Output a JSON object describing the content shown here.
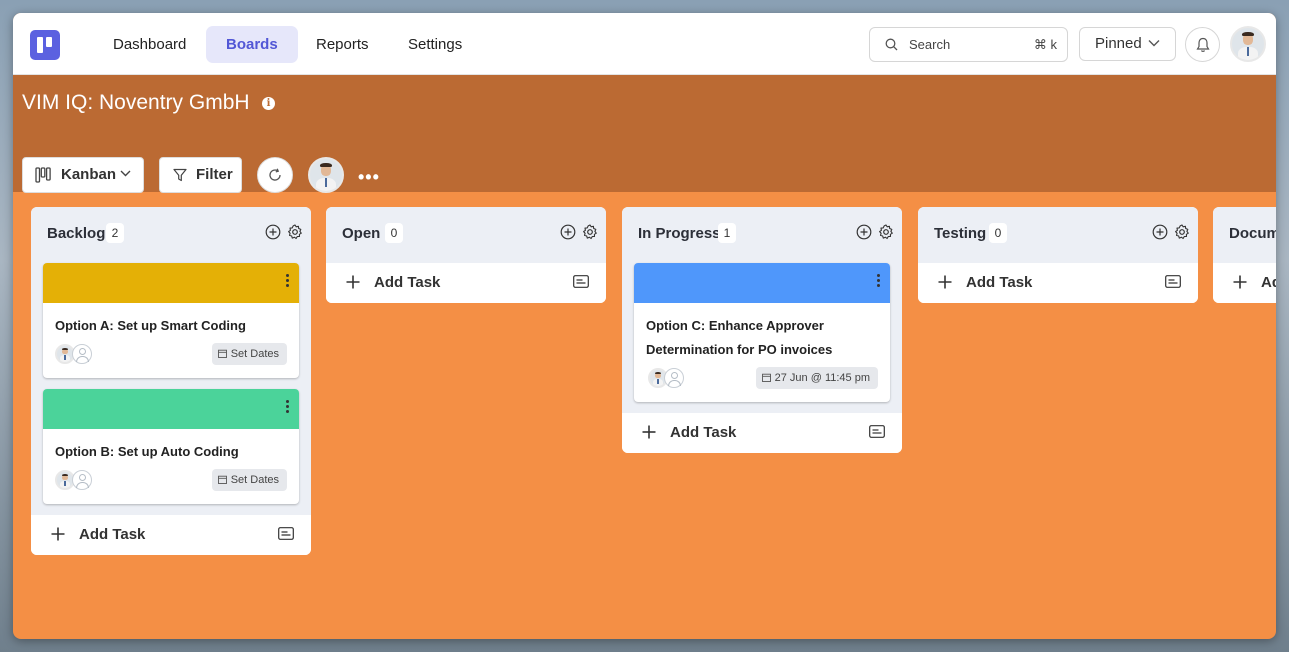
{
  "nav": {
    "links": [
      "Dashboard",
      "Boards",
      "Reports",
      "Settings"
    ],
    "active": "Boards",
    "search_label": "Search",
    "search_shortcut": "⌘ k",
    "pinned_label": "Pinned"
  },
  "board": {
    "title": "VIM IQ: Noventry GmbH",
    "view_label": "Kanban",
    "filter_label": "Filter",
    "background_color": "#f48f45",
    "header_color": "#bb6a33",
    "accent_color": "#5b61e0"
  },
  "columns": [
    {
      "title": "Backlog",
      "count": "2",
      "add_task_label": "Add Task",
      "cards": [
        {
          "title": "Option A: Set up Smart Coding",
          "band_color": "#e4b006",
          "date": "Set Dates"
        },
        {
          "title": "Option B: Set up Auto Coding",
          "band_color": "#4bd39a",
          "date": "Set Dates"
        }
      ]
    },
    {
      "title": "Open",
      "count": "0",
      "add_task_label": "Add Task",
      "cards": []
    },
    {
      "title": "In Progress",
      "count": "1",
      "add_task_label": "Add Task",
      "cards": [
        {
          "title": "Option C: Enhance Approver Determination for PO invoices",
          "band_color": "#4f97fb",
          "date": "27 Jun @ 11:45 pm"
        }
      ]
    },
    {
      "title": "Testing",
      "count": "0",
      "add_task_label": "Add Task",
      "cards": []
    },
    {
      "title": "Docum",
      "add_task_label": "Ad",
      "cards": []
    }
  ]
}
